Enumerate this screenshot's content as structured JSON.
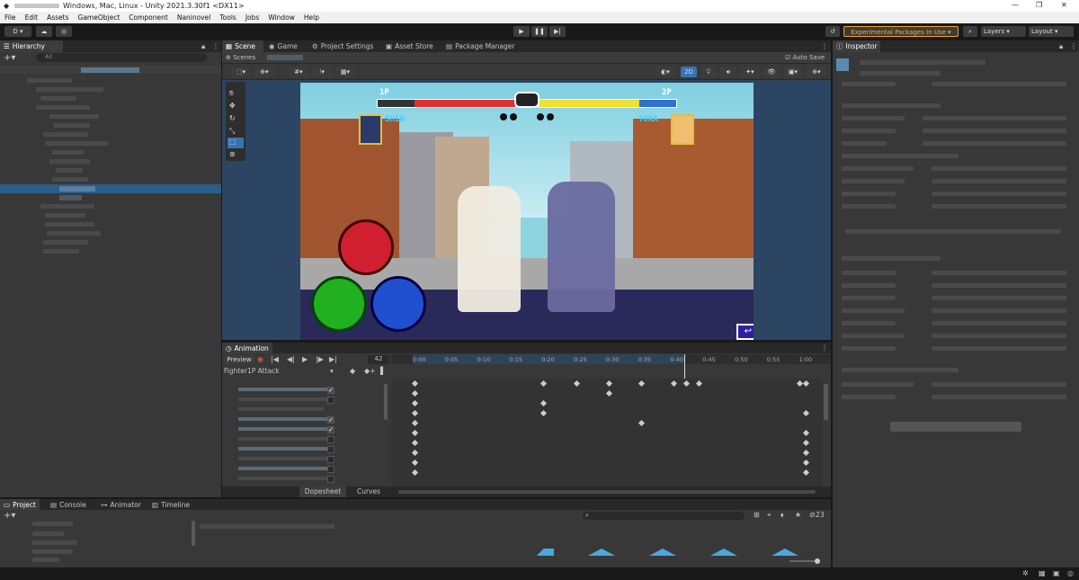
{
  "window": {
    "title": "Windows, Mac, Linux - Unity 2021.3.30f1 <DX11>"
  },
  "menu": [
    "File",
    "Edit",
    "Assets",
    "GameObject",
    "Component",
    "Naninovel",
    "Tools",
    "Jobs",
    "Window",
    "Help"
  ],
  "toolbar": {
    "account": "D",
    "experimental": "Experimental Packages In Use",
    "layers": "Layers",
    "layout": "Layout"
  },
  "hierarchy": {
    "title": "Hierarchy",
    "search_placeholder": "All"
  },
  "scene_tabs": [
    "Scene",
    "Game",
    "Project Settings",
    "Asset Store",
    "Package Manager"
  ],
  "scene": {
    "scenes_label": "Scenes",
    "auto_save": "Auto Save",
    "mode_2d": "2D"
  },
  "game": {
    "p1_label": "1P",
    "p2_label": "2P",
    "p1_name": "SHIN",
    "p2_name": "TORA",
    "p1_health": 0.73,
    "p2_health": 0.73
  },
  "animation": {
    "title": "Animation",
    "preview": "Preview",
    "frame": "42",
    "clip": "Fighter1P Attack",
    "ticks": [
      "0:00",
      "0:05",
      "0:10",
      "0:15",
      "0:20",
      "0:25",
      "0:30",
      "0:35",
      "0:40",
      "0:45",
      "0:50",
      "0:55",
      "1:00"
    ],
    "dopesheet": "Dopesheet",
    "curves": "Curves"
  },
  "inspector": {
    "title": "Inspector"
  },
  "bottom_tabs": [
    "Project",
    "Console",
    "Animator",
    "Timeline"
  ],
  "project": {
    "badge": "23"
  },
  "colors": {
    "accent": "#3a72b0",
    "experimental_border": "#f0a020",
    "health_red": "#e03030",
    "health_yellow": "#f0e030"
  }
}
